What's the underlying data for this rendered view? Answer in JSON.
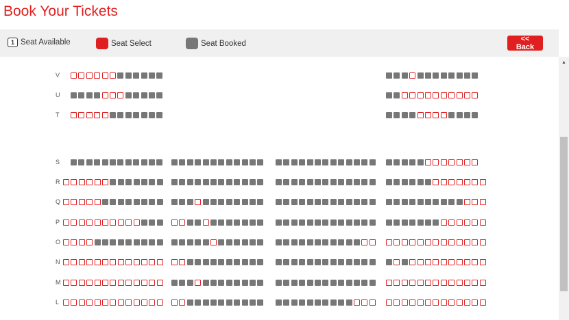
{
  "page_title": "Book Your Tickets",
  "legend": {
    "available_label": "Seat Available",
    "available_number": "1",
    "select_label": "Seat Select",
    "booked_label": "Seat Booked"
  },
  "back_button_label": "<< Back",
  "colors": {
    "accent": "#e02020",
    "booked": "#777777",
    "legend_bar": "#f0f0f0"
  },
  "upper_rows": [
    {
      "label": "V",
      "left": "aaaaaabbbbbb",
      "right": "bbbabbbbbbbb"
    },
    {
      "label": "U",
      "left": "bbbbaaabbbbb",
      "right": "bbaaaaaaaaaa"
    },
    {
      "label": "T",
      "left": "aaaaabbbbbbb",
      "right": "bbbbaaaabbbb"
    }
  ],
  "lower_rows": [
    {
      "label": "S",
      "blocks": [
        "bbbbbbbbbbbb",
        "bbbbbbbbbbbb",
        "bbbbbbbbbbbbb",
        "bbbbbaaaaaaa"
      ]
    },
    {
      "label": "R",
      "blocks": [
        "aaaaaabbbbbbb",
        "bbbbbbbbbbbb",
        "bbbbbbbbbbbbb",
        "bbbbbbaaaaaaa"
      ]
    },
    {
      "label": "Q",
      "blocks": [
        "aaaaabbbbbbbb",
        "bbbabbbbbbbb",
        "bbbbbbbbbbbbb",
        "bbbbbbbbbbaaa"
      ]
    },
    {
      "label": "P",
      "blocks": [
        "aaaaaaaaaabbb",
        "aabbabbbbbbb",
        "bbbbbbbbbbbbb",
        "bbbbbbbaaaaaa"
      ]
    },
    {
      "label": "O",
      "blocks": [
        "aaaabbbbbbbbb",
        "bbbbbabbbbbb",
        "bbbbbbbbbbbaa",
        "aaaaaaaaaaaaa"
      ]
    },
    {
      "label": "N",
      "blocks": [
        "aaaaaaaaaaaaa",
        "aabbbbbbbbbb",
        "bbbbbbbbbbbbb",
        "babaaaaaaaaaa"
      ]
    },
    {
      "label": "M",
      "blocks": [
        "aaaaaaaaaaaaa",
        "bbbabbbbbbbb",
        "bbbbbbbbbbbbb",
        "aaaaaaaaaaaaa"
      ]
    },
    {
      "label": "L",
      "blocks": [
        "aaaaaaaaaaaaa",
        "aabbbbbbbbbb",
        "bbbbbbbbbbaaa",
        "aaaaaaaaaaaaa"
      ]
    }
  ]
}
